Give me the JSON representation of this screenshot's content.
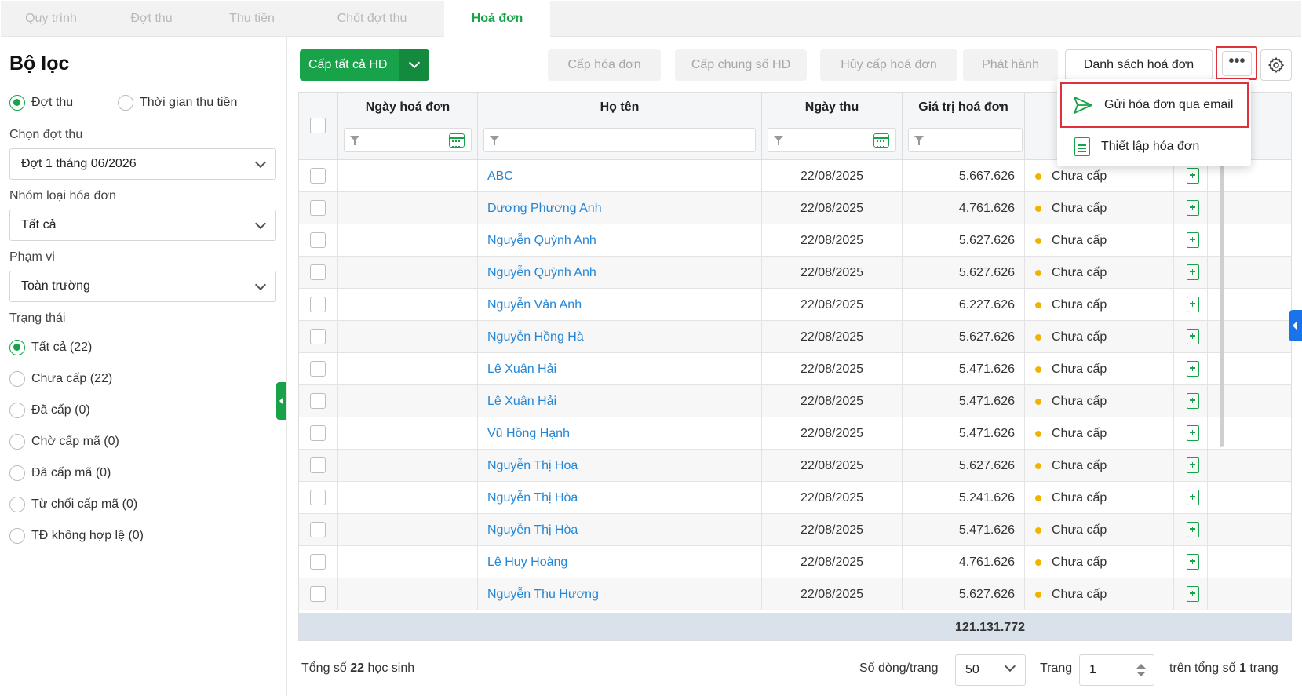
{
  "tabs": [
    {
      "label": "Quy trình"
    },
    {
      "label": "Đợt thu"
    },
    {
      "label": "Thu tiền"
    },
    {
      "label": "Chốt đợt thu"
    },
    {
      "label": "Hoá đơn"
    }
  ],
  "active_tab": "Hoá đơn",
  "filter": {
    "title": "Bộ lọc",
    "mode_options": [
      "Đợt thu",
      "Thời gian thu tiền"
    ],
    "mode_selected": "Đợt thu",
    "dot_label": "Chọn đợt thu",
    "dot_value": "Đợt 1 tháng 06/2026",
    "group_label": "Nhóm loại hóa đơn",
    "group_value": "Tất cả",
    "scope_label": "Phạm vi",
    "scope_value": "Toàn trường",
    "status_label": "Trạng thái",
    "status_options": [
      "Tất cả (22)",
      "Chưa cấp (22)",
      "Đã cấp (0)",
      "Chờ cấp mã (0)",
      "Đã cấp mã (0)",
      "Từ chối cấp mã (0)",
      "TĐ không hợp lệ (0)"
    ],
    "status_selected": "Tất cả (22)"
  },
  "toolbar": {
    "primary": "Cấp tất cả HĐ",
    "issue": "Cấp hóa đơn",
    "issue_shared": "Cấp chung số HĐ",
    "cancel_issue": "Hủy cấp hoá đơn",
    "publish": "Phát hành",
    "list": "Danh sách hoá đơn",
    "more": "•••"
  },
  "menu": {
    "send_email": "Gửi hóa đơn qua email",
    "settings": "Thiết lập hóa đơn"
  },
  "table": {
    "columns": {
      "date": "Ngày hoá đơn",
      "name": "Họ tên",
      "paid_date": "Ngày thu",
      "value": "Giá trị hoá đơn"
    },
    "rows": [
      {
        "name": "ABC",
        "paid": "22/08/2025",
        "value": "5.667.626",
        "status": "Chưa cấp"
      },
      {
        "name": "Dương Phương Anh",
        "paid": "22/08/2025",
        "value": "4.761.626",
        "status": "Chưa cấp"
      },
      {
        "name": "Nguyễn Quỳnh Anh",
        "paid": "22/08/2025",
        "value": "5.627.626",
        "status": "Chưa cấp"
      },
      {
        "name": "Nguyễn Quỳnh Anh",
        "paid": "22/08/2025",
        "value": "5.627.626",
        "status": "Chưa cấp"
      },
      {
        "name": "Nguyễn Vân Anh",
        "paid": "22/08/2025",
        "value": "6.227.626",
        "status": "Chưa cấp"
      },
      {
        "name": "Nguyễn Hồng Hà",
        "paid": "22/08/2025",
        "value": "5.627.626",
        "status": "Chưa cấp"
      },
      {
        "name": "Lê Xuân Hải",
        "paid": "22/08/2025",
        "value": "5.471.626",
        "status": "Chưa cấp"
      },
      {
        "name": "Lê Xuân Hải",
        "paid": "22/08/2025",
        "value": "5.471.626",
        "status": "Chưa cấp"
      },
      {
        "name": "Vũ Hồng Hạnh",
        "paid": "22/08/2025",
        "value": "5.471.626",
        "status": "Chưa cấp"
      },
      {
        "name": "Nguyễn Thị Hoa",
        "paid": "22/08/2025",
        "value": "5.627.626",
        "status": "Chưa cấp"
      },
      {
        "name": "Nguyễn Thị Hòa",
        "paid": "22/08/2025",
        "value": "5.241.626",
        "status": "Chưa cấp"
      },
      {
        "name": "Nguyễn Thị Hòa",
        "paid": "22/08/2025",
        "value": "5.471.626",
        "status": "Chưa cấp"
      },
      {
        "name": "Lê Huy Hoàng",
        "paid": "22/08/2025",
        "value": "4.761.626",
        "status": "Chưa cấp"
      },
      {
        "name": "Nguyễn Thu Hương",
        "paid": "22/08/2025",
        "value": "5.627.626",
        "status": "Chưa cấp"
      }
    ],
    "total": "121.131.772"
  },
  "pager": {
    "total_prefix": "Tổng số",
    "total_count": "22",
    "total_suffix": "học sinh",
    "rows_label": "Số dòng/trang",
    "rows_value": "50",
    "page_label": "Trang",
    "page_value": "1",
    "of_prefix": "trên tổng số",
    "of_count": "1",
    "of_suffix": "trang"
  },
  "colors": {
    "accent": "#18a34a",
    "link": "#2386d6",
    "status_pending": "#f0b400",
    "highlight_border": "#e0313b"
  }
}
